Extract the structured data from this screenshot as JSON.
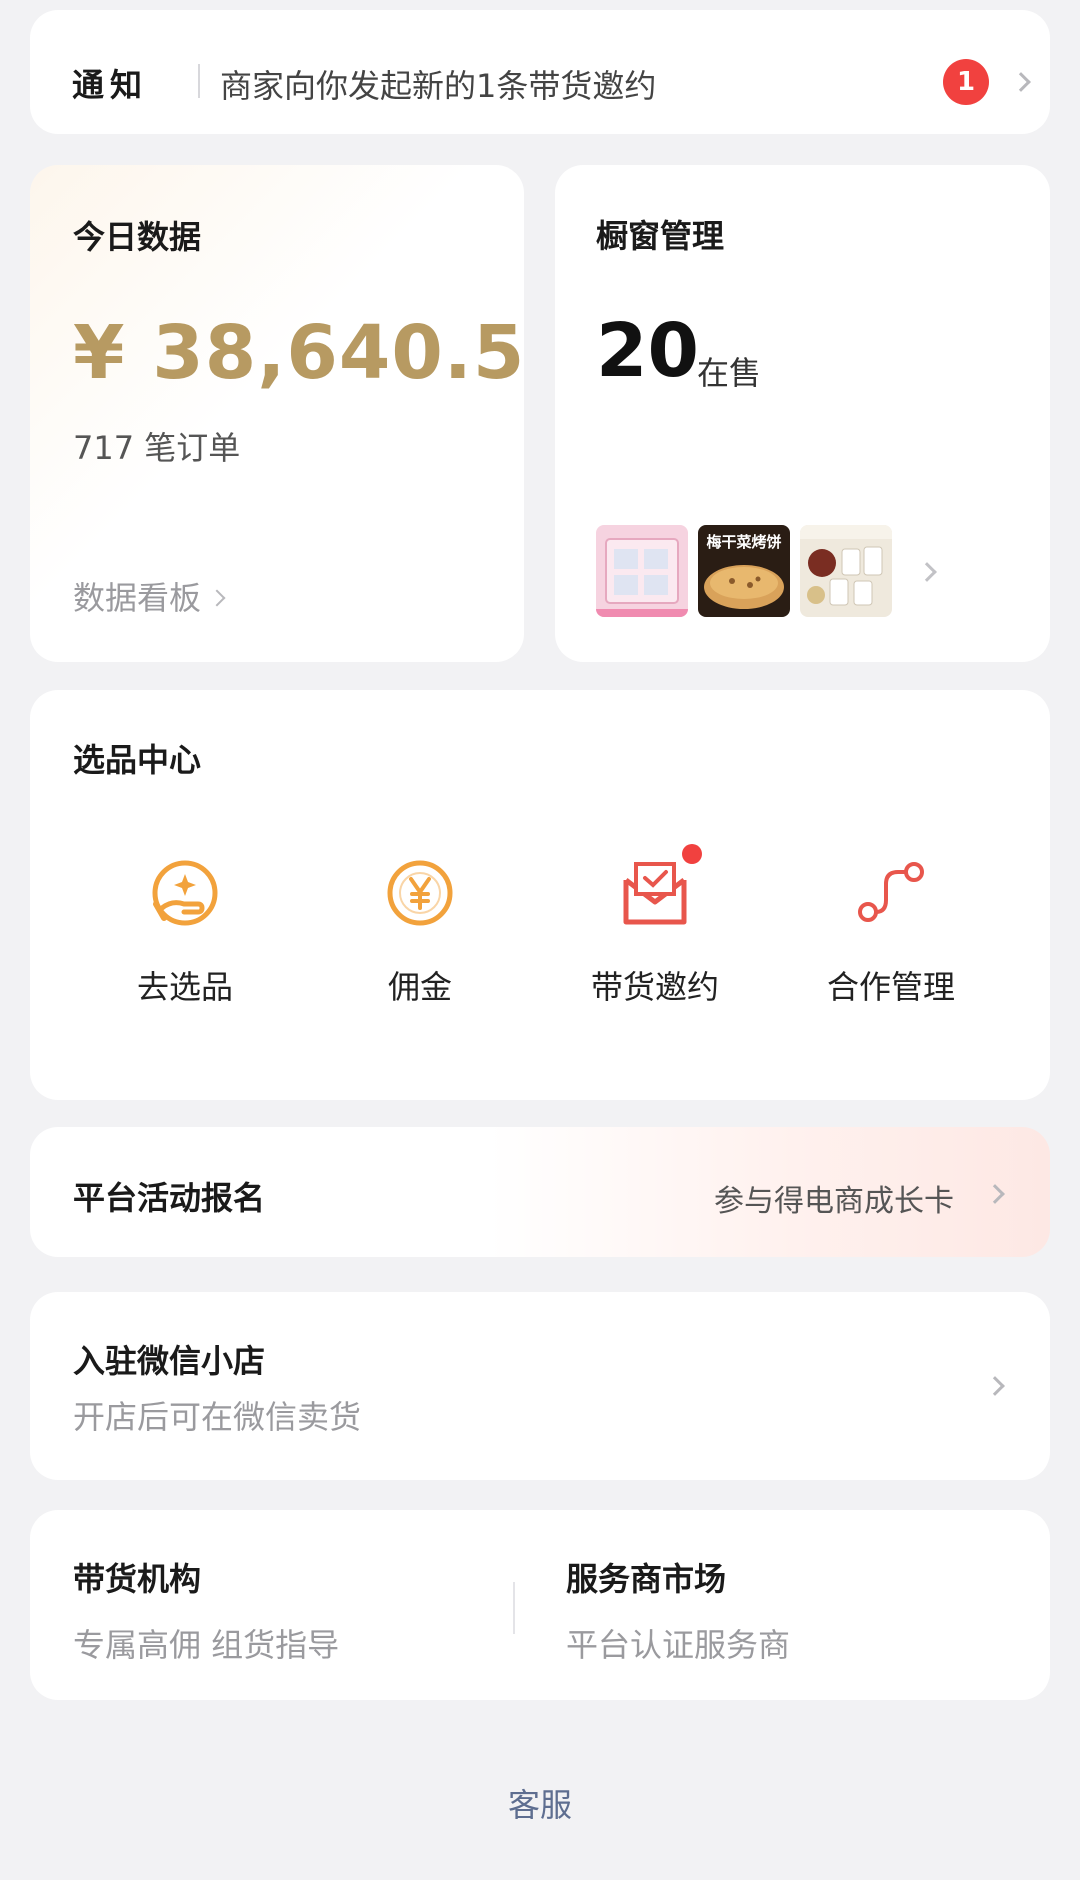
{
  "notice": {
    "label": "通知",
    "message": "商家向你发起新的1条带货邀约",
    "badge_count": "1"
  },
  "today": {
    "title": "今日数据",
    "amount": "¥ 38,640.5",
    "orders": "717 笔订单",
    "dashboard_link": "数据看板"
  },
  "showcase": {
    "title": "橱窗管理",
    "count": "20",
    "count_label": "在售",
    "thumbnails": [
      {
        "icon": "product-thumbnail-pink-box"
      },
      {
        "icon": "product-thumbnail-pancake",
        "text": "梅干菜烤饼"
      },
      {
        "icon": "product-thumbnail-food-cups"
      }
    ]
  },
  "selection_center": {
    "title": "选品中心",
    "items": [
      {
        "label": "去选品",
        "icon": "hand-star-icon"
      },
      {
        "label": "佣金",
        "icon": "yen-coin-icon"
      },
      {
        "label": "带货邀约",
        "icon": "envelope-check-icon"
      },
      {
        "label": "合作管理",
        "icon": "connection-path-icon"
      }
    ]
  },
  "activity": {
    "title": "平台活动报名",
    "right_text": "参与得电商成长卡"
  },
  "shop": {
    "title": "入驻微信小店",
    "subtitle": "开店后可在微信卖货"
  },
  "institutions": {
    "left_title": "带货机构",
    "left_subtitle": "专属高佣 组货指导",
    "right_title": "服务商市场",
    "right_subtitle": "平台认证服务商"
  },
  "footer": {
    "service_link": "客服"
  },
  "colors": {
    "accent_gold": "#b79a62",
    "icon_orange": "#f2a23c",
    "icon_red": "#e8564c",
    "badge_red": "#f1413f",
    "link_blue_gray": "#5e6e90"
  }
}
